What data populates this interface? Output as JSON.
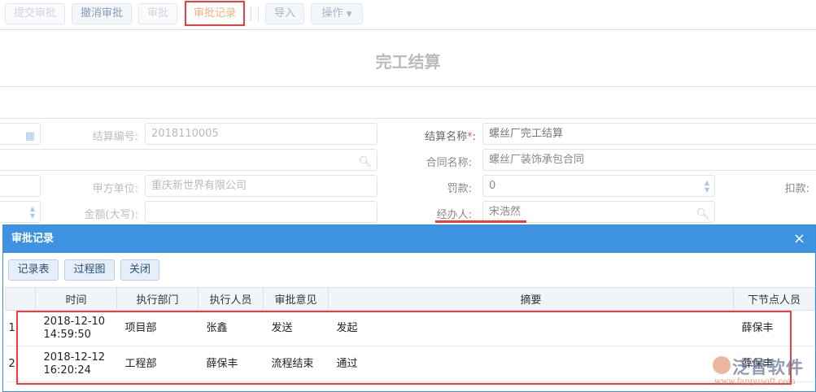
{
  "toolbar": {
    "submit": "提交审批",
    "cancel": "撤消审批",
    "approve": "审批",
    "record": "审批记录",
    "import": "导入",
    "ops": "操作"
  },
  "page_title": "完工结算",
  "form": {
    "settle_no_label": "结算编号:",
    "settle_no": "2018110005",
    "settle_name_label": "结算名称",
    "settle_name_req": "*",
    "colon": ":",
    "settle_name": "螺丝厂完工结算",
    "contract_label": "合同名称:",
    "contract": "螺丝厂装饰承包合同",
    "party_a_label": "甲方单位:",
    "party_a": "重庆新世界有限公司",
    "fine_label": "罚款:",
    "fine": "0",
    "deduct_label": "扣款:",
    "amount_cn_label": "金额(大写):",
    "handler_label": "经办人:",
    "handler": "宋浩然"
  },
  "dialog": {
    "title": "审批记录",
    "buttons": [
      "记录表",
      "过程图",
      "关闭"
    ],
    "columns": [
      "",
      "时间",
      "执行部门",
      "执行人员",
      "审批意见",
      "摘要",
      "下节点人员"
    ],
    "rows": [
      {
        "idx": "1",
        "date": "2018-12-10",
        "time": "14:59:50",
        "dept": "项目部",
        "person": "张鑫",
        "opinion": "发送",
        "summary": "发起",
        "next": "薛保丰"
      },
      {
        "idx": "2",
        "date": "2018-12-12",
        "time": "16:20:24",
        "dept": "工程部",
        "person": "薛保丰",
        "opinion": "流程结束",
        "summary": "通过",
        "next": "薛保丰"
      }
    ]
  },
  "watermark": {
    "name": "泛普软件",
    "url": "www.fanpusoft.com"
  }
}
